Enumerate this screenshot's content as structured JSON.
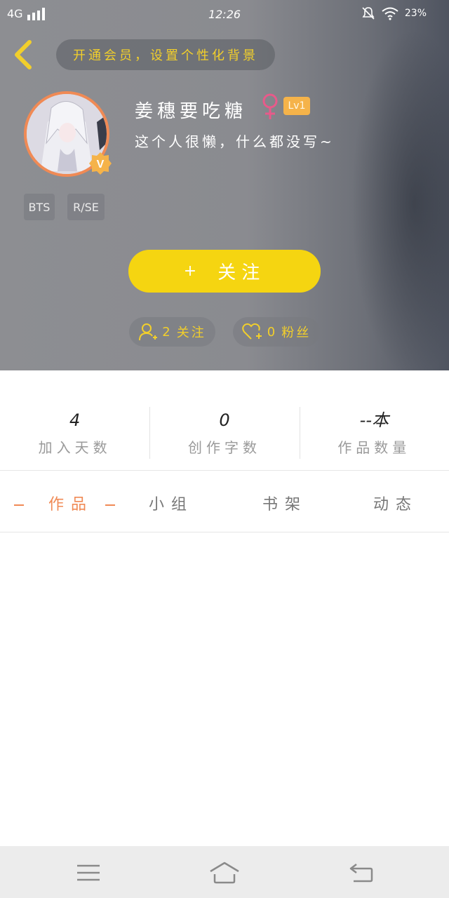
{
  "status_bar": {
    "network": "4G",
    "time": "12:26",
    "battery": "23%"
  },
  "header": {
    "banner_tip": "开通会员，设置个性化背景",
    "username": "姜穗要吃糖",
    "level": "Lv1",
    "bio": "这个人很懒，什么都没写~",
    "tags": [
      "BTS",
      "R/SE"
    ],
    "follow_button": {
      "icon": "+",
      "label": "关注"
    },
    "following": {
      "count": "2",
      "label": "关注"
    },
    "followers": {
      "count": "0",
      "label": "粉丝"
    }
  },
  "stats": [
    {
      "value": "4",
      "label": "加入天数"
    },
    {
      "value": "0",
      "label": "创作字数"
    },
    {
      "value": "--本",
      "label": "作品数量"
    }
  ],
  "tabs": [
    {
      "label": "作品",
      "active": true
    },
    {
      "label": "小组",
      "active": false
    },
    {
      "label": "书架",
      "active": false
    },
    {
      "label": "动态",
      "active": false
    }
  ],
  "colors": {
    "accent_orange": "#f08a55",
    "follow_yellow": "#f5d511",
    "tip_yellow": "#f2cf2b",
    "level_badge": "#f5b34a",
    "gender_pink": "#e85a8a"
  },
  "icons": {
    "back": "chevron-left-icon",
    "gender": "female-icon",
    "vip": "v-badge-icon",
    "follow": "add-user-icon",
    "fans": "heart-add-icon",
    "nav_menu": "menu-icon",
    "nav_home": "home-icon",
    "nav_back": "back-arrow-icon"
  }
}
